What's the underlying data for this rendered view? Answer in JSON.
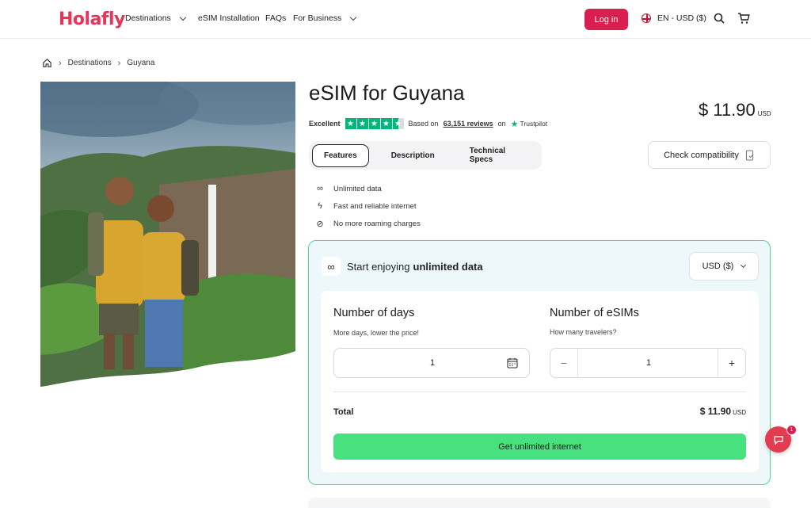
{
  "brand": {
    "logo": "Holafly",
    "accent": "#e6345a"
  },
  "nav": {
    "destinations": "Destinations",
    "esim_installation": "eSIM Installation",
    "faqs": "FAQs",
    "for_business": "For Business",
    "login": "Log in",
    "language": "EN - USD ($)"
  },
  "breadcrumb": {
    "items": [
      "Destinations",
      "Guyana"
    ]
  },
  "product": {
    "title": "eSIM for Guyana",
    "price": "$ 11.90",
    "currency": "USD",
    "rating_label": "Excellent",
    "reviews_prefix": "Based on",
    "reviews_count": "63,151 reviews",
    "reviews_suffix": "on",
    "trustpilot": "Trustpilot"
  },
  "tabs": [
    "Features",
    "Description",
    "Technical Specs"
  ],
  "check_compat": "Check compatibility",
  "features": [
    "Unlimited data",
    "Fast and reliable internet",
    "No more roaming charges"
  ],
  "panel": {
    "head_prefix": "Start enjoying",
    "head_bold": "unlimited data",
    "currency_select": "USD ($)",
    "days_title": "Number of days",
    "days_sub": "More days, lower the price!",
    "days_value": "1",
    "esims_title": "Number of eSIMs",
    "esims_sub": "How many travelers?",
    "esims_value": "1",
    "minus": "−",
    "plus": "+",
    "total_label": "Total",
    "total_value": "$ 11.90",
    "total_currency": "USD",
    "cta": "Get unlimited internet"
  },
  "chat": {
    "badge": "1"
  }
}
